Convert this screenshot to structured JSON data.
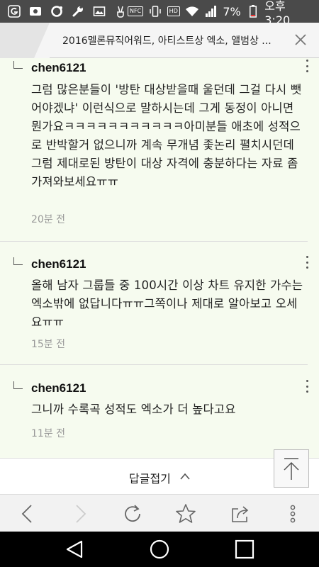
{
  "status_bar": {
    "left_icons": [
      "G-icon",
      "notification-icon",
      "chat-icon",
      "wrench-icon",
      "image-icon",
      "victory-icon"
    ],
    "nfc": "NFC",
    "hd": "HD",
    "battery": "7%",
    "time": "오후 3:20"
  },
  "tab": {
    "title": "2016멜론뮤직어워드, 아티스트상 엑소, 앨범상 ..."
  },
  "comments": [
    {
      "author": "chen6121",
      "text": "그럼 많은분들이 '방탄 대상받을때 울던데 그걸 다시 뺏어야겠냐' 이런식으로 말하시는데 그게 동정이 아니면 뭔가요ㅋㅋㅋㅋㅋㅋㅋㅋㅋㅋㅋ아미분들 애초에 성적으로 반박할거 없으니까 계속 무개념 좇논리 펼치시던데 그럼 제대로된 방탄이 대상 자격에 충분하다는 자료 좀 가져와보세요ㅠㅠ",
      "time": "20분 전"
    },
    {
      "author": "chen6121",
      "text": "올해 남자 그룹들 중 100시간 이상 차트 유지한 가수는 엑소밖에 없답니다ㅠㅠ그쪽이나 제대로 알아보고 오세요ㅠㅠ",
      "time": "15분 전"
    },
    {
      "author": "chen6121",
      "text": "그니까 수록곡 성적도 엑소가 더 높다고요",
      "time": "11분 전"
    }
  ],
  "collapse": {
    "label": "답글접기"
  }
}
